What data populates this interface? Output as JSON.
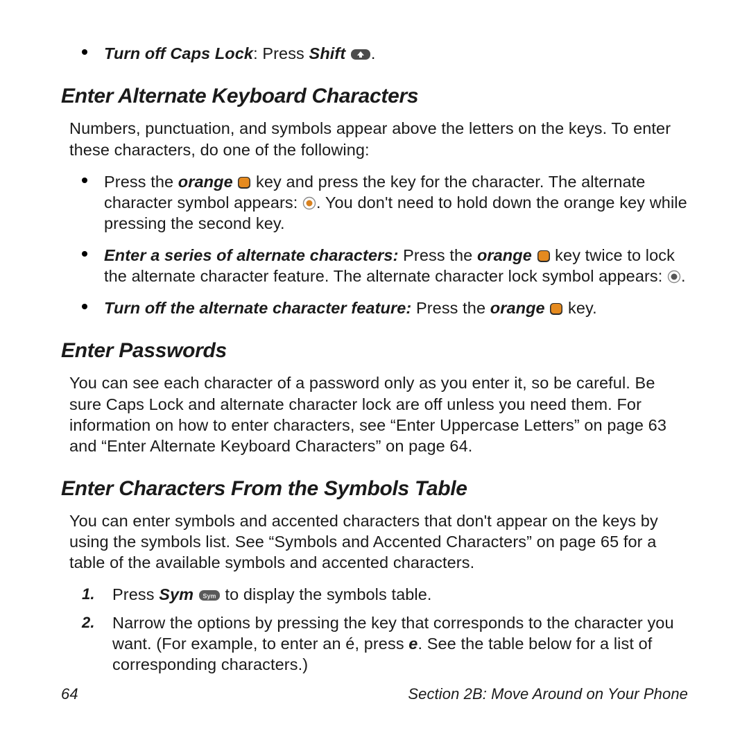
{
  "bullet0": {
    "a": "Turn off Caps Lock",
    "b": ": Press ",
    "c": "Shift",
    "d": "."
  },
  "h1": "Enter Alternate Keyboard Characters",
  "p1": "Numbers, punctuation, and symbols appear above the letters on the keys. To enter these characters, do one of the following:",
  "bul1": {
    "a": "Press the ",
    "b": "orange",
    "c": " key and press the key for the character. The alternate character symbol appears: ",
    "d": ". You don't need to hold down the orange key while pressing the second key."
  },
  "bul2": {
    "a": "Enter a series of alternate characters:",
    "b": " Press the ",
    "c": "orange",
    "d": " key twice to lock the alternate character feature. The alternate character lock symbol appears: ",
    "e": "."
  },
  "bul3": {
    "a": "Turn off the alternate character feature:",
    "b": " Press the ",
    "c": "orange",
    "d": " key."
  },
  "h2": "Enter Passwords",
  "p2": "You can see each character of a password only as you enter it, so be careful. Be sure Caps Lock and alternate character lock are off unless you need them. For information on how to enter characters, see “Enter Uppercase Letters” on page 63 and “Enter Alternate Keyboard Characters” on page 64.",
  "h3": "Enter Characters From the Symbols Table",
  "p3": "You can enter symbols and accented characters that don't appear on the keys by using the symbols list. See “Symbols and Accented Characters” on page 65 for a table of the available symbols and accented characters.",
  "n1": {
    "num": "1.",
    "a": "Press ",
    "b": "Sym",
    "c": " to display the symbols table."
  },
  "n2": {
    "num": "2.",
    "a": "Narrow the options by pressing the key that corresponds to the character you want. (For example, to enter an é, press ",
    "b": "e",
    "c": ". See the table below for a list of corresponding characters.)"
  },
  "footer": {
    "page": "64",
    "section": "Section 2B: Move Around on Your Phone"
  }
}
